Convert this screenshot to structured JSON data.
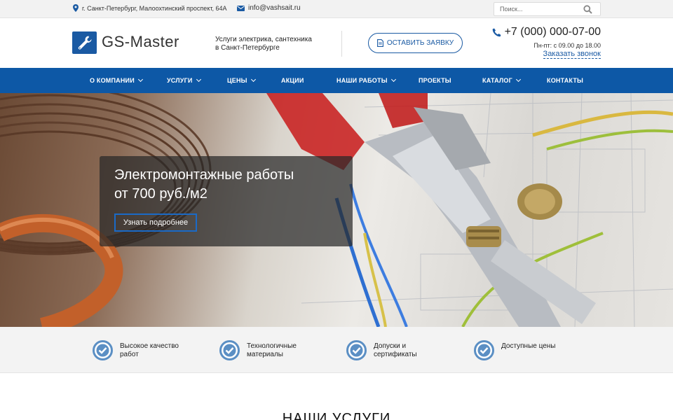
{
  "topbar": {
    "address": "г. Санкт-Петербург, Малоохтинский проспект, 64А",
    "email": "info@vashsait.ru",
    "search_placeholder": "Поиск..."
  },
  "header": {
    "logo_text": "GS-Master",
    "tagline_line1": "Услуги электрика, сантехника",
    "tagline_line2": "в Санкт-Петербурге",
    "request_button": "ОСТАВИТЬ ЗАЯВКУ",
    "phone": "+7 (000) 000-07-00",
    "hours": "Пн-пт: с 09.00 до 18.00",
    "callback": "Заказать звонок"
  },
  "nav": {
    "items": [
      {
        "label": "О КОМПАНИИ",
        "dropdown": true
      },
      {
        "label": "УСЛУГИ",
        "dropdown": true
      },
      {
        "label": "ЦЕНЫ",
        "dropdown": true
      },
      {
        "label": "АКЦИИ",
        "dropdown": false
      },
      {
        "label": "НАШИ РАБОТЫ",
        "dropdown": true
      },
      {
        "label": "ПРОЕКТЫ",
        "dropdown": false
      },
      {
        "label": "КАТАЛОГ",
        "dropdown": true
      },
      {
        "label": "КОНТАКТЫ",
        "dropdown": false
      }
    ]
  },
  "hero": {
    "line1": "Электромонтажные работы",
    "line2": "от 700 руб./м2",
    "button": "Узнать подробнее"
  },
  "features": [
    {
      "line1": "Высокое качество",
      "line2": "работ"
    },
    {
      "line1": "Технологичные",
      "line2": "материалы"
    },
    {
      "line1": "Допуски и",
      "line2": "сертификаты"
    },
    {
      "line1": "Доступные цены",
      "line2": ""
    }
  ],
  "services": {
    "title": "НАШИ УСЛУГИ"
  },
  "colors": {
    "brand": "#0d58a6",
    "accent": "#1a5aa3",
    "check": "#5b8fc4"
  }
}
